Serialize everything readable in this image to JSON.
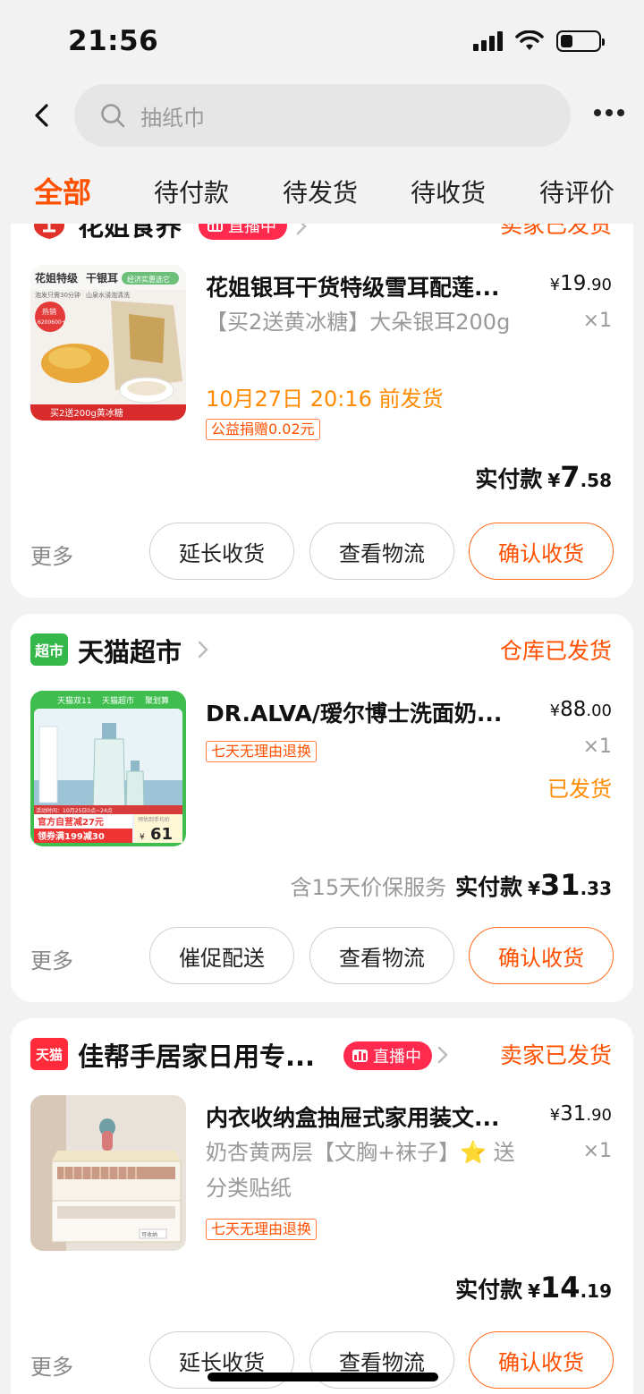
{
  "status_bar": {
    "time": "21:56"
  },
  "search": {
    "placeholder": "抽纸巾"
  },
  "tabs": [
    "全部",
    "待付款",
    "待发货",
    "待收货",
    "待评价"
  ],
  "orders": [
    {
      "shop": "花姐食养",
      "live": "直播中",
      "status": "卖家已发货",
      "title": "花姐银耳干货特级雪耳配莲...",
      "sku": "【买2送黄冰糖】大朵银耳200g",
      "ship_time": "10月27日 20:16 前发货",
      "tag": "公益捐赠0.02元",
      "price_int": "19",
      "price_dec": ".90",
      "qty": "×1",
      "paid_label": "实付款",
      "paid_int": "7",
      "paid_dec": ".58",
      "more": "更多",
      "buttons": [
        "延长收货",
        "查看物流",
        "确认收货"
      ]
    },
    {
      "shop": "天猫超市",
      "status": "仓库已发货",
      "title": "DR.ALVA/瑷尔博士洗面奶...",
      "tag": "七天无理由退换",
      "price_int": "88",
      "price_dec": ".00",
      "qty": "×1",
      "item_status": "已发货",
      "protect": "含15天价保服务",
      "paid_label": "实付款",
      "paid_int": "31",
      "paid_dec": ".33",
      "more": "更多",
      "buttons": [
        "催促配送",
        "查看物流",
        "确认收货"
      ]
    },
    {
      "shop": "佳帮手居家日用专...",
      "live": "直播中",
      "status": "卖家已发货",
      "title": "内衣收纳盒抽屉式家用装文...",
      "sku": "奶杏黄两层【文胸+袜子】⭐ 送分类贴纸",
      "tag": "七天无理由退换",
      "price_int": "31",
      "price_dec": ".90",
      "qty": "×1",
      "paid_label": "实付款",
      "paid_int": "14",
      "paid_dec": ".19",
      "more": "更多",
      "buttons": [
        "延长收货",
        "查看物流",
        "确认收货"
      ]
    }
  ],
  "thumb_text": {
    "o1_a": "花姐特级",
    "o1_b": "干银耳",
    "o1_c": "经济实惠选它",
    "o1_d": "泡发只需30分钟",
    "o1_e": "山泉水浸泡清洗",
    "o1_f": "热销",
    "o1_g": "6200600+",
    "o1_h": "买2送200g黄冰糖",
    "o2_a": "天猫双11",
    "o2_b": "天猫超市",
    "o2_c": "聚划算",
    "o2_d": "活动时间：10月25日0点~24点",
    "o2_e": "官方自营减27元",
    "o2_f": "领券满199减30",
    "o2_g": "预估到手均价",
    "o2_h": "61",
    "o3_a": "可收纳"
  },
  "shop_logos": {
    "o2": "超市",
    "o3": "天猫"
  },
  "colors": {
    "accent": "#ff5000",
    "live": "#ff2a4d",
    "ship_time": "#ff8a00"
  }
}
